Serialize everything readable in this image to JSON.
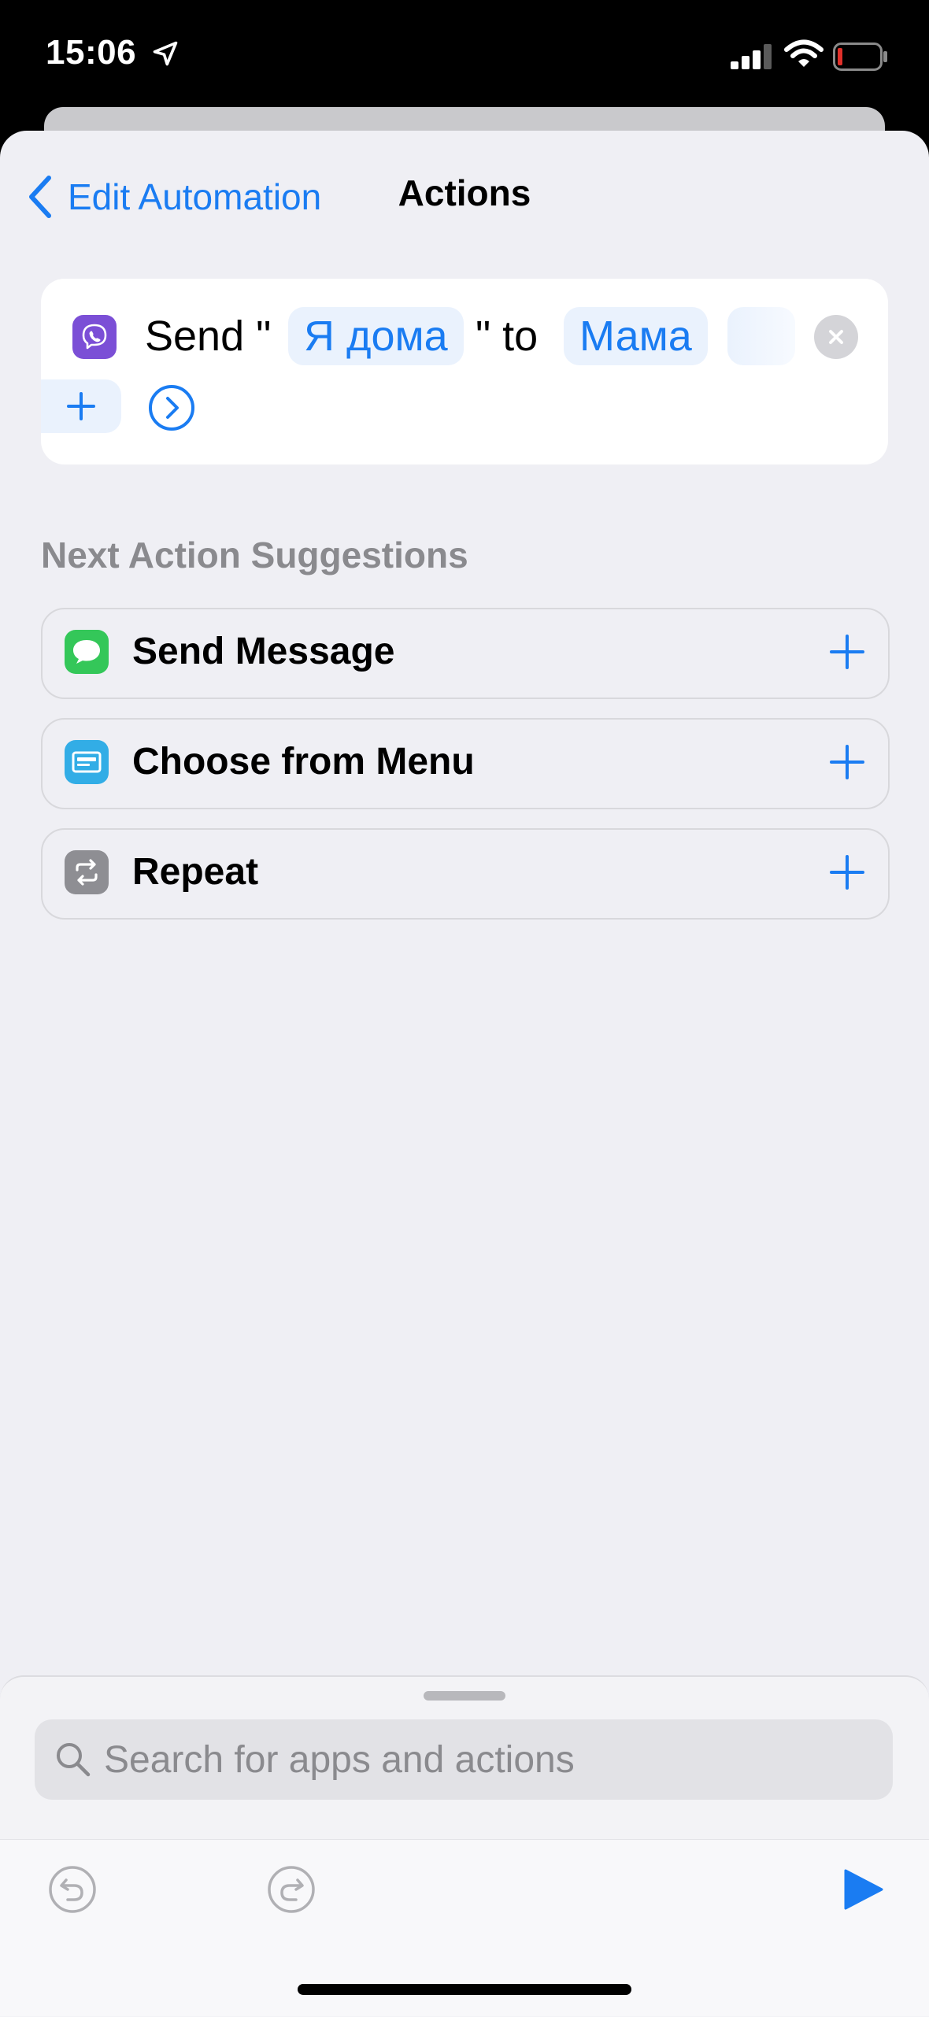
{
  "status_bar": {
    "time": "15:06",
    "location_icon": "location-arrow-icon",
    "signal_icon": "cellular-signal-icon",
    "wifi_icon": "wifi-icon",
    "battery_icon": "battery-low-icon",
    "battery_color": "#e0302a"
  },
  "nav": {
    "back_label": "Edit Automation",
    "title": "Actions",
    "accent_color": "#1a7cf2"
  },
  "action": {
    "app_icon": "viber-icon",
    "app_color": "#7b4fd6",
    "prefix": "Send \"",
    "message": "Я дома",
    "middle": "\" to",
    "contact": "Мама"
  },
  "suggestions": {
    "heading": "Next Action Suggestions",
    "items": [
      {
        "label": "Send Message",
        "icon": "messages-icon",
        "color": "#34c759"
      },
      {
        "label": "Choose from Menu",
        "icon": "menu-icon",
        "color": "#32ade6"
      },
      {
        "label": "Repeat",
        "icon": "repeat-icon",
        "color": "#8e8e93"
      }
    ]
  },
  "bottom": {
    "search_placeholder": "Search for apps and actions",
    "undo_icon": "undo-icon",
    "redo_icon": "redo-icon",
    "play_icon": "play-icon"
  }
}
